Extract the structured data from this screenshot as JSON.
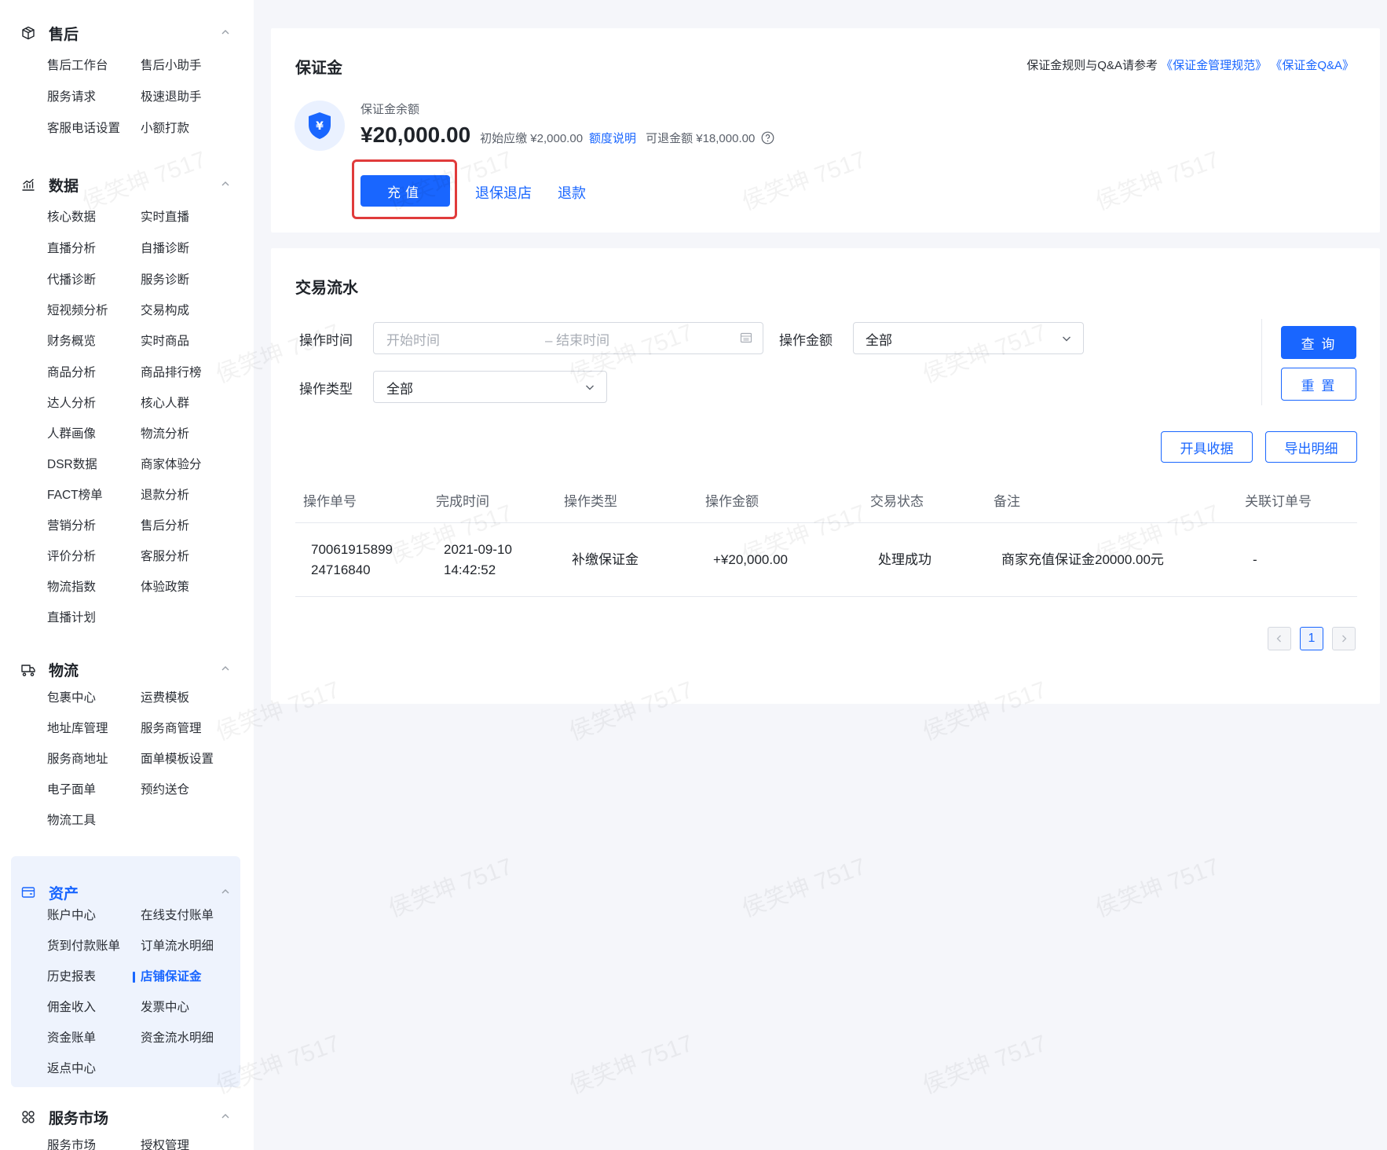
{
  "sidebar": {
    "sections": [
      {
        "title": "售后",
        "icon": "package-icon",
        "items": [
          "售后工作台",
          "售后小助手",
          "服务请求",
          "极速退助手",
          "客服电话设置",
          "小额打款"
        ]
      },
      {
        "title": "数据",
        "icon": "chart-icon",
        "items": [
          "核心数据",
          "实时直播",
          "直播分析",
          "自播诊断",
          "代播诊断",
          "服务诊断",
          "短视频分析",
          "交易构成",
          "财务概览",
          "实时商品",
          "商品分析",
          "商品排行榜",
          "达人分析",
          "核心人群",
          "人群画像",
          "物流分析",
          "DSR数据",
          "商家体验分",
          "FACT榜单",
          "退款分析",
          "营销分析",
          "售后分析",
          "评价分析",
          "客服分析",
          "物流指数",
          "体验政策",
          "直播计划"
        ]
      },
      {
        "title": "物流",
        "icon": "truck-icon",
        "items": [
          "包裹中心",
          "运费模板",
          "地址库管理",
          "服务商管理",
          "服务商地址",
          "面单模板设置",
          "电子面单",
          "预约送仓",
          "物流工具"
        ]
      },
      {
        "title": "资产",
        "icon": "wallet-icon",
        "items": [
          "账户中心",
          "在线支付账单",
          "货到付款账单",
          "订单流水明细",
          "历史报表",
          "店铺保证金",
          "佣金收入",
          "发票中心",
          "资金账单",
          "资金流水明细",
          "返点中心"
        ]
      },
      {
        "title": "服务市场",
        "icon": "grid-icon",
        "items": [
          "服务市场",
          "授权管理"
        ]
      }
    ]
  },
  "deposit": {
    "title": "保证金",
    "rules_prefix": "保证金规则与Q&A请参考",
    "rules_link1": "《保证金管理规范》",
    "rules_link2": "《保证金Q&A》",
    "balance_label": "保证金余额",
    "balance_amount": "¥20,000.00",
    "initial_due": "初始应缴 ¥2,000.00",
    "quota_link": "额度说明",
    "refundable": "可退金额 ¥18,000.00",
    "recharge_button": "充值",
    "exit_link": "退保退店",
    "refund_link": "退款"
  },
  "transactions": {
    "title": "交易流水",
    "filters": {
      "time_label": "操作时间",
      "start_placeholder": "开始时间",
      "end_placeholder": "– 结束时间",
      "amount_label": "操作金额",
      "amount_value": "全部",
      "type_label": "操作类型",
      "type_value": "全部"
    },
    "query_button": "查 询",
    "reset_button": "重 置",
    "receipt_button": "开具收据",
    "export_button": "导出明细",
    "columns": [
      "操作单号",
      "完成时间",
      "操作类型",
      "操作金额",
      "交易状态",
      "备注",
      "关联订单号"
    ],
    "rows": [
      {
        "id_line1": "70061915899",
        "id_line2": "24716840",
        "date": "2021-09-10",
        "time": "14:42:52",
        "type": "补缴保证金",
        "amount": "+¥20,000.00",
        "status": "处理成功",
        "remark": "商家充值保证金20000.00元",
        "order": "-"
      }
    ],
    "page": "1"
  },
  "watermark": "侯笑坤 7517",
  "colors": {
    "primary": "#1966ff",
    "highlight": "#e03b3b",
    "background": "#f5f6fa"
  }
}
